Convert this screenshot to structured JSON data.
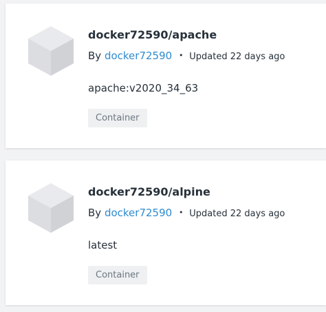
{
  "results": [
    {
      "title": "docker72590/apache",
      "by_label": "By",
      "author": "docker72590",
      "bullet": "•",
      "updated": "Updated 22 days ago",
      "tag": "apache:v2020_34_63",
      "badge": "Container",
      "icon": "cube-icon"
    },
    {
      "title": "docker72590/alpine",
      "by_label": "By",
      "author": "docker72590",
      "bullet": "•",
      "updated": "Updated 22 days ago",
      "tag": "latest",
      "badge": "Container",
      "icon": "cube-icon"
    }
  ],
  "colors": {
    "link": "#2e8bd0",
    "text": "#27313a",
    "badge_bg": "#eef0f2",
    "cube_top": "#e8e9ec",
    "cube_left": "#dcdde1",
    "cube_right": "#cfd1d5"
  }
}
